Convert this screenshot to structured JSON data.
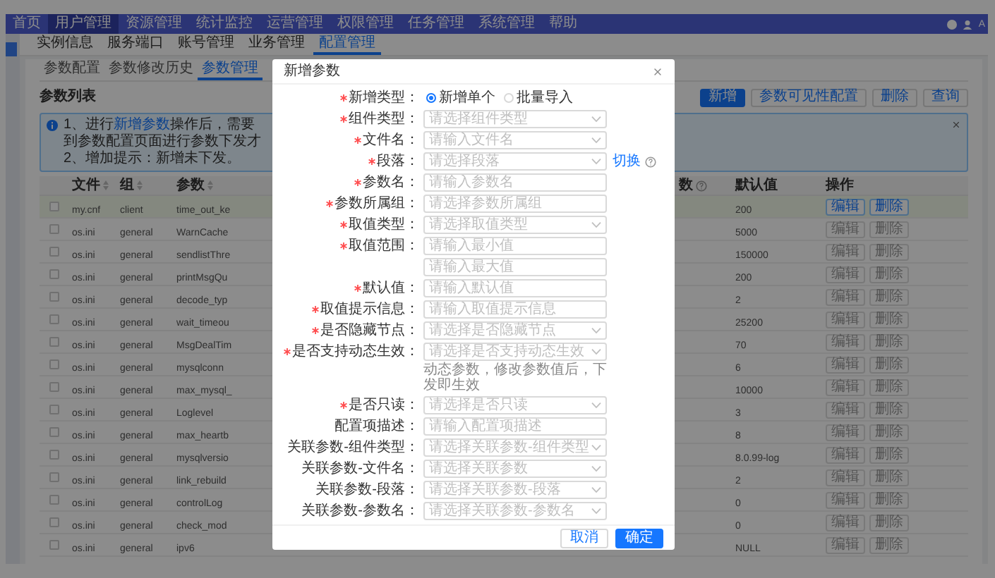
{
  "nav": {
    "items": [
      {
        "label": "首页",
        "selected": false
      },
      {
        "label": "用户管理",
        "selected": true
      },
      {
        "label": "资源管理",
        "selected": false
      },
      {
        "label": "统计监控",
        "selected": false
      },
      {
        "label": "运营管理",
        "selected": false
      },
      {
        "label": "权限管理",
        "selected": false
      },
      {
        "label": "任务管理",
        "selected": false
      },
      {
        "label": "系统管理",
        "selected": false
      },
      {
        "label": "帮助",
        "selected": false
      }
    ],
    "user": "A"
  },
  "subnav": [
    {
      "label": "实例信息",
      "selected": false
    },
    {
      "label": "服务端口",
      "selected": false
    },
    {
      "label": "账号管理",
      "selected": false
    },
    {
      "label": "业务管理",
      "selected": false
    },
    {
      "label": "配置管理",
      "selected": true
    }
  ],
  "tabs": [
    {
      "label": "参数配置",
      "selected": false
    },
    {
      "label": "参数修改历史",
      "selected": false
    },
    {
      "label": "参数管理",
      "selected": true
    }
  ],
  "title": "参数列表",
  "toolbar": [
    {
      "label": "新增",
      "kind": "primary"
    },
    {
      "label": "参数可见性配置",
      "kind": "default"
    },
    {
      "label": "删除",
      "kind": "default"
    },
    {
      "label": "查询",
      "kind": "default"
    }
  ],
  "alert": {
    "lines": [
      {
        "text": "1、进行",
        "link": "新增参数",
        "rest": "操作后，需要到参数配置页面进行参数下发才"
      },
      {
        "text": "2、增加提示：新增未下发。"
      }
    ]
  },
  "table": {
    "columns": [
      {
        "label": "文件",
        "sortable": true
      },
      {
        "label": "组",
        "sortable": true
      },
      {
        "label": "参数",
        "sortable": true
      },
      {
        "label": "数",
        "info": true
      },
      {
        "label": "默认值"
      },
      {
        "label": "操作"
      }
    ],
    "rows": [
      {
        "file": "my.cnf",
        "group": "client",
        "param": "time_out_ke",
        "default": "200",
        "selected": true,
        "checked": false,
        "actions": [
          "编辑",
          "删除"
        ]
      },
      {
        "file": "os.ini",
        "group": "general",
        "param": "WarnCache",
        "default": "5000",
        "selected": false,
        "checked": false,
        "actions": [
          "编辑",
          "删除"
        ]
      },
      {
        "file": "os.ini",
        "group": "general",
        "param": "sendlistThre",
        "default": "150000",
        "selected": false,
        "checked": false,
        "actions": [
          "编辑",
          "删除"
        ]
      },
      {
        "file": "os.ini",
        "group": "general",
        "param": "printMsgQu",
        "default": "200",
        "selected": false,
        "checked": false,
        "actions": [
          "编辑",
          "删除"
        ]
      },
      {
        "file": "os.ini",
        "group": "general",
        "param": "decode_typ",
        "default": "2",
        "selected": false,
        "checked": false,
        "actions": [
          "编辑",
          "删除"
        ]
      },
      {
        "file": "os.ini",
        "group": "general",
        "param": "wait_timeou",
        "default": "25200",
        "selected": false,
        "checked": false,
        "actions": [
          "编辑",
          "删除"
        ]
      },
      {
        "file": "os.ini",
        "group": "general",
        "param": "MsgDealTim",
        "default": "70",
        "selected": false,
        "checked": false,
        "actions": [
          "编辑",
          "删除"
        ]
      },
      {
        "file": "os.ini",
        "group": "general",
        "param": "mysqlconn",
        "default": "6",
        "selected": false,
        "checked": false,
        "actions": [
          "编辑",
          "删除"
        ]
      },
      {
        "file": "os.ini",
        "group": "general",
        "param": "max_mysql_",
        "default": "10000",
        "selected": false,
        "checked": false,
        "actions": [
          "编辑",
          "删除"
        ]
      },
      {
        "file": "os.ini",
        "group": "general",
        "param": "Loglevel",
        "default": "3",
        "selected": false,
        "checked": false,
        "actions": [
          "编辑",
          "删除"
        ]
      },
      {
        "file": "os.ini",
        "group": "general",
        "param": "max_heartb",
        "default": "8",
        "selected": false,
        "checked": false,
        "actions": [
          "编辑",
          "删除"
        ]
      },
      {
        "file": "os.ini",
        "group": "general",
        "param": "mysqlversio",
        "default": "8.0.99-log",
        "selected": false,
        "checked": false,
        "actions": [
          "编辑",
          "删除"
        ]
      },
      {
        "file": "os.ini",
        "group": "general",
        "param": "link_rebuild",
        "default": "2",
        "selected": false,
        "checked": false,
        "actions": [
          "编辑",
          "删除"
        ]
      },
      {
        "file": "os.ini",
        "group": "general",
        "param": "controlLog",
        "default": "0",
        "selected": false,
        "checked": false,
        "actions": [
          "编辑",
          "删除"
        ]
      },
      {
        "file": "os.ini",
        "group": "general",
        "param": "check_mod",
        "default": "0",
        "selected": false,
        "checked": false,
        "actions": [
          "编辑",
          "删除"
        ]
      },
      {
        "file": "os.ini",
        "group": "general",
        "param": "ipv6",
        "default": "NULL",
        "selected": false,
        "checked": false,
        "actions": [
          "编辑",
          "删除"
        ]
      }
    ]
  },
  "modal": {
    "title": "新增参数",
    "fields": [
      {
        "kind": "radio",
        "label": "新增类型：",
        "required": true,
        "options": [
          {
            "label": "新增单个",
            "selected": true
          },
          {
            "label": "批量导入",
            "selected": false
          }
        ]
      },
      {
        "kind": "select",
        "label": "组件类型：",
        "required": true,
        "placeholder": "请选择组件类型"
      },
      {
        "kind": "select",
        "label": "文件名：",
        "required": true,
        "placeholder": "请输入文件名"
      },
      {
        "kind": "select",
        "label": "段落：",
        "required": true,
        "placeholder": "请选择段落",
        "link": "切换",
        "help": true
      },
      {
        "kind": "input",
        "label": "参数名：",
        "required": true,
        "placeholder": "请输入参数名"
      },
      {
        "kind": "input",
        "label": "参数所属组：",
        "required": true,
        "placeholder": "请选择参数所属组"
      },
      {
        "kind": "select",
        "label": "取值类型：",
        "required": true,
        "placeholder": "请选择取值类型"
      },
      {
        "kind": "input",
        "label": "取值范围：",
        "required": true,
        "placeholder": "请输入最小值"
      },
      {
        "kind": "input",
        "placeholder": "请输入最大值"
      },
      {
        "kind": "input",
        "label": "默认值：",
        "required": true,
        "placeholder": "请输入默认值"
      },
      {
        "kind": "input",
        "label": "取值提示信息：",
        "required": true,
        "placeholder": "请输入取值提示信息"
      },
      {
        "kind": "select",
        "label": "是否隐藏节点：",
        "required": true,
        "placeholder": "请选择是否隐藏节点"
      },
      {
        "kind": "select",
        "label": "是否支持动态生效：",
        "required": true,
        "placeholder": "请选择是否支持动态生效",
        "hint": "动态参数，修改参数值后，下发即生效"
      },
      {
        "kind": "select",
        "label": "是否只读：",
        "required": true,
        "placeholder": "请选择是否只读"
      },
      {
        "kind": "input",
        "label": "配置项描述：",
        "required": false,
        "placeholder": "请输入配置项描述"
      },
      {
        "kind": "select",
        "label": "关联参数-组件类型：",
        "required": false,
        "placeholder": "请选择关联参数-组件类型"
      },
      {
        "kind": "select",
        "label": "关联参数-文件名：",
        "required": false,
        "placeholder": "请选择关联参数"
      },
      {
        "kind": "select",
        "label": "关联参数-段落：",
        "required": false,
        "placeholder": "请选择关联参数-段落"
      },
      {
        "kind": "select",
        "label": "关联参数-参数名：",
        "required": false,
        "placeholder": "请选择关联参数-参数名"
      }
    ],
    "buttons": [
      {
        "label": "取消",
        "kind": "default"
      },
      {
        "label": "确定",
        "kind": "primary"
      }
    ]
  }
}
